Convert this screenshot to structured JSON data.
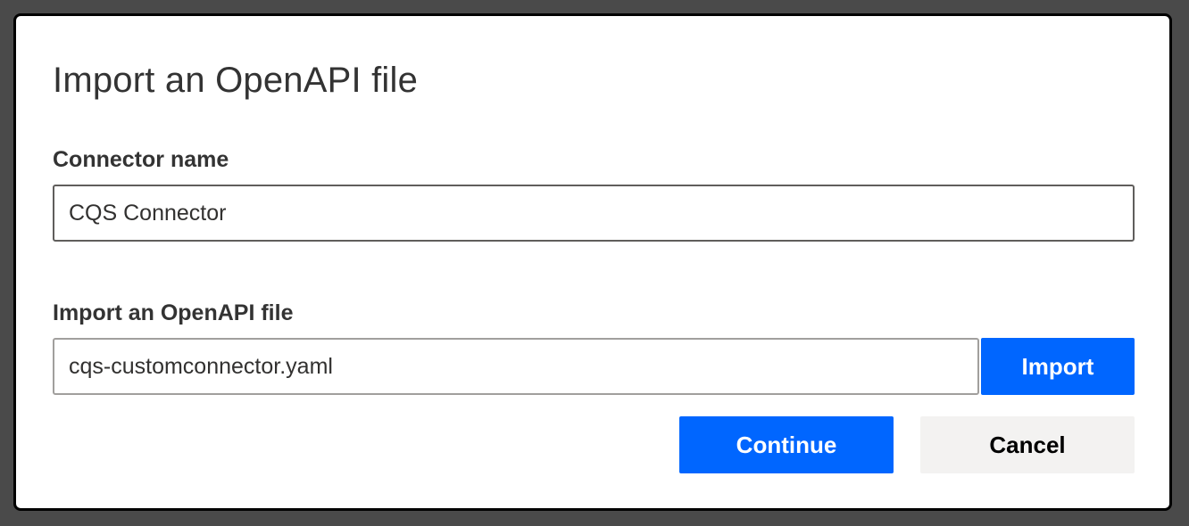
{
  "dialog": {
    "title": "Import an OpenAPI file",
    "connector_name": {
      "label": "Connector name",
      "value": "CQS Connector"
    },
    "openapi_file": {
      "label": "Import an OpenAPI file",
      "value": "cqs-customconnector.yaml",
      "import_button_label": "Import"
    },
    "actions": {
      "continue_label": "Continue",
      "cancel_label": "Cancel"
    }
  },
  "colors": {
    "primary": "#0066ff",
    "secondary_button": "#f3f2f1",
    "backdrop": "#4a4a4a",
    "text": "#333333"
  }
}
